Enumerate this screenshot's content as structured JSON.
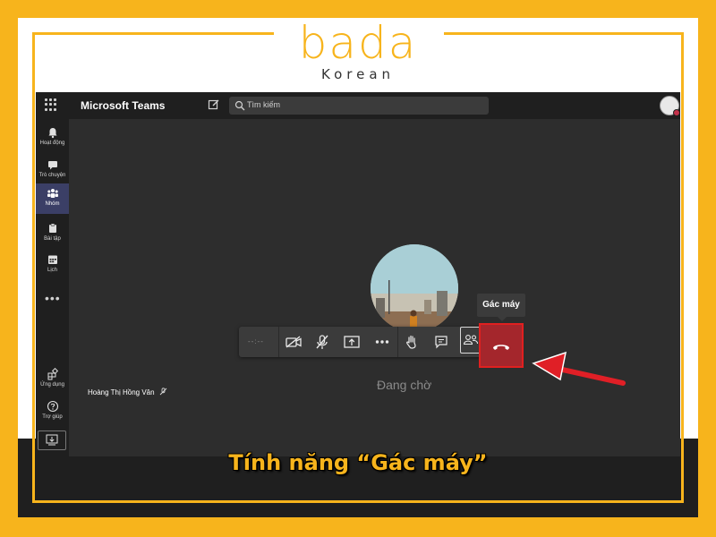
{
  "logo": {
    "word": "bada",
    "sub": "Korean"
  },
  "teams": {
    "app_title": "Microsoft Teams",
    "search_placeholder": "Tìm kiếm",
    "rail": [
      {
        "label": "Hoạt động",
        "icon": "bell-icon"
      },
      {
        "label": "Trò chuyện",
        "icon": "chat-icon"
      },
      {
        "label": "Nhóm",
        "icon": "teams-icon"
      },
      {
        "label": "Bài tập",
        "icon": "assignments-icon"
      },
      {
        "label": "Lịch",
        "icon": "calendar-icon"
      }
    ],
    "rail_bottom": [
      {
        "label": "Ứng dụng",
        "icon": "apps-icon"
      },
      {
        "label": "Trợ giúp",
        "icon": "help-icon"
      }
    ],
    "more_label": "•••",
    "call": {
      "timer": "--:--",
      "participant_name": "Hoàng Thị Hồng Vân",
      "waiting_text": "Đang chờ",
      "tooltip": "Gác máy",
      "hangup_color": "#a4262c"
    }
  },
  "caption": "Tính năng “Gác máy”",
  "colors": {
    "brand_gold": "#f7b41c",
    "arrow_red": "#e01f26"
  }
}
